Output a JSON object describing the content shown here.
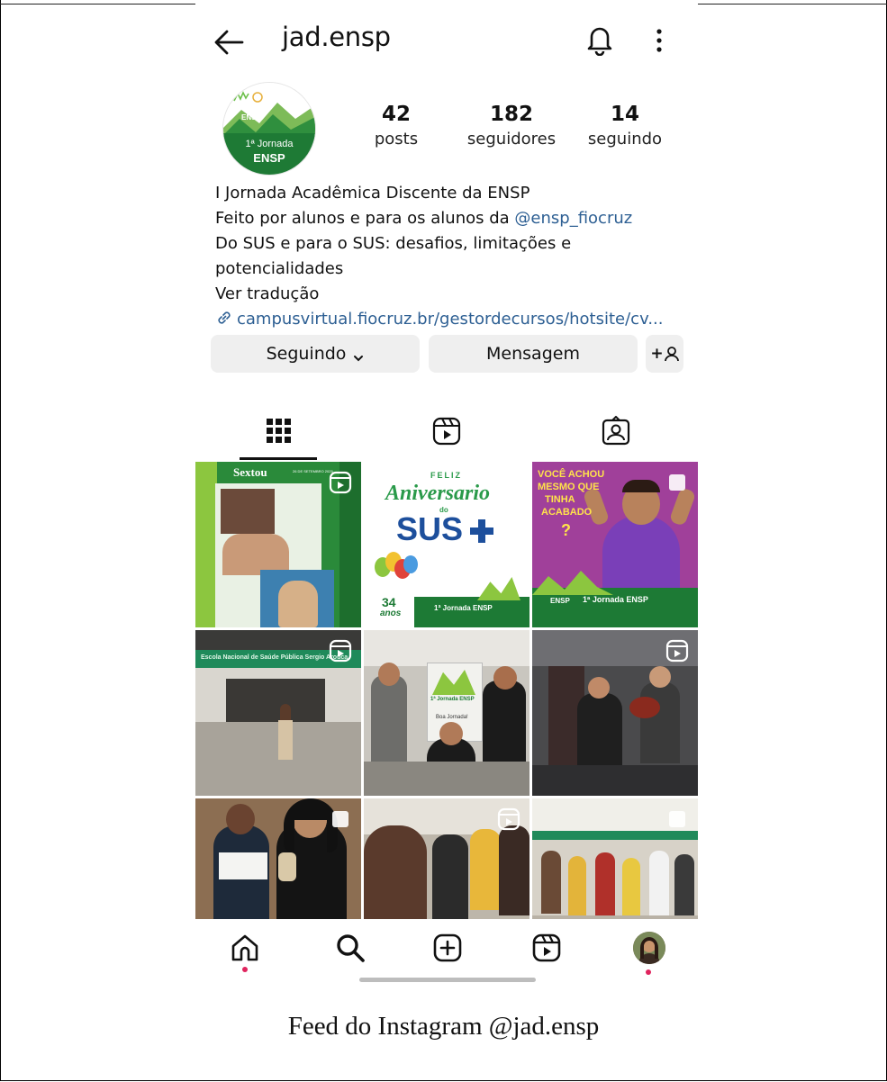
{
  "header": {
    "username": "jad.ensp",
    "icons": [
      "back-arrow-icon",
      "bell-icon",
      "more-vertical-icon"
    ]
  },
  "profile": {
    "avatar_text_line1": "ENSP",
    "avatar_text_line2": "1ª Jornada",
    "avatar_text_line3": "ENSP",
    "stats": [
      {
        "value": "42",
        "label": "posts"
      },
      {
        "value": "182",
        "label": "seguidores"
      },
      {
        "value": "14",
        "label": "seguindo"
      }
    ],
    "bio": {
      "line1": "I Jornada Acadêmica Discente da ENSP",
      "line2_prefix": "Feito por alunos e para os alunos da ",
      "line2_mention": "@ensp_fiocruz",
      "line3": "Do SUS e para o SUS:  desafios, limitações e",
      "line4": "potencialidades",
      "line5": "Ver tradução",
      "link": "campusvirtual.fiocruz.br/gestordecursos/hotsite/cv..."
    },
    "buttons": {
      "following": "Seguindo",
      "message": "Mensagem",
      "add_person": "+"
    }
  },
  "tabs": [
    "grid-icon",
    "reels-icon",
    "tagged-icon"
  ],
  "posts": {
    "p1": {
      "title": "Sextou",
      "subtitle": "26 DE SETEMBRO 2025"
    },
    "p2": {
      "line1": "FELIZ",
      "line2": "Aniversario",
      "line3": "do",
      "line4": "SUS",
      "years_num": "34",
      "years_word": "anos",
      "footer": "1ª Jornada ENSP"
    },
    "p3": {
      "line1": "VOCÊ ACHOU",
      "line2": "MESMO QUE",
      "line3": "TINHA",
      "line4": "ACABADO",
      "line5": "?",
      "footer_left": "ENSP",
      "footer": "1ª Jornada ENSP"
    },
    "p4": {
      "banner": "Escola Nacional de Saúde Pública Sergio Arouca"
    },
    "p5": {
      "sign": "1ª Jornada ENSP",
      "sub": "Boa Jornada!"
    },
    "p6": {},
    "p7": {},
    "p8": {},
    "p9": {}
  },
  "bottom_nav": [
    "home-icon",
    "search-icon",
    "create-icon",
    "reels-icon",
    "profile-avatar"
  ],
  "caption": "Feed do Instagram @jad.ensp"
}
